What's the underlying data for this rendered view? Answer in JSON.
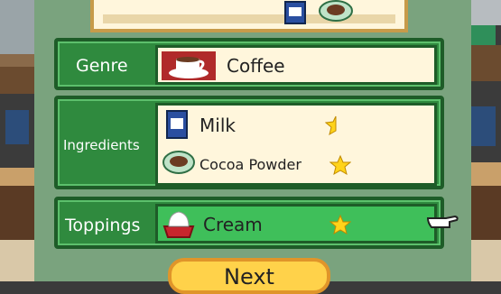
{
  "recipe": {
    "genre": {
      "label": "Genre",
      "value": "Coffee",
      "icon": "coffee-cup-icon"
    },
    "ingredients": {
      "label": "Ingredients",
      "items": [
        {
          "name": "Milk",
          "icon": "milk-carton-icon",
          "star": "half"
        },
        {
          "name": "Cocoa Powder",
          "icon": "cocoa-bowl-icon",
          "star": "full"
        }
      ]
    },
    "toppings": {
      "label": "Toppings",
      "value": "Cream",
      "icon": "cream-bowl-icon",
      "star": "full"
    }
  },
  "buttons": {
    "next": "Next"
  },
  "colors": {
    "panel_green": "#2f8a3e",
    "cell_bg": "#fff6dc",
    "highlight": "#3fbf5a",
    "button_yellow": "#ffd24a"
  }
}
